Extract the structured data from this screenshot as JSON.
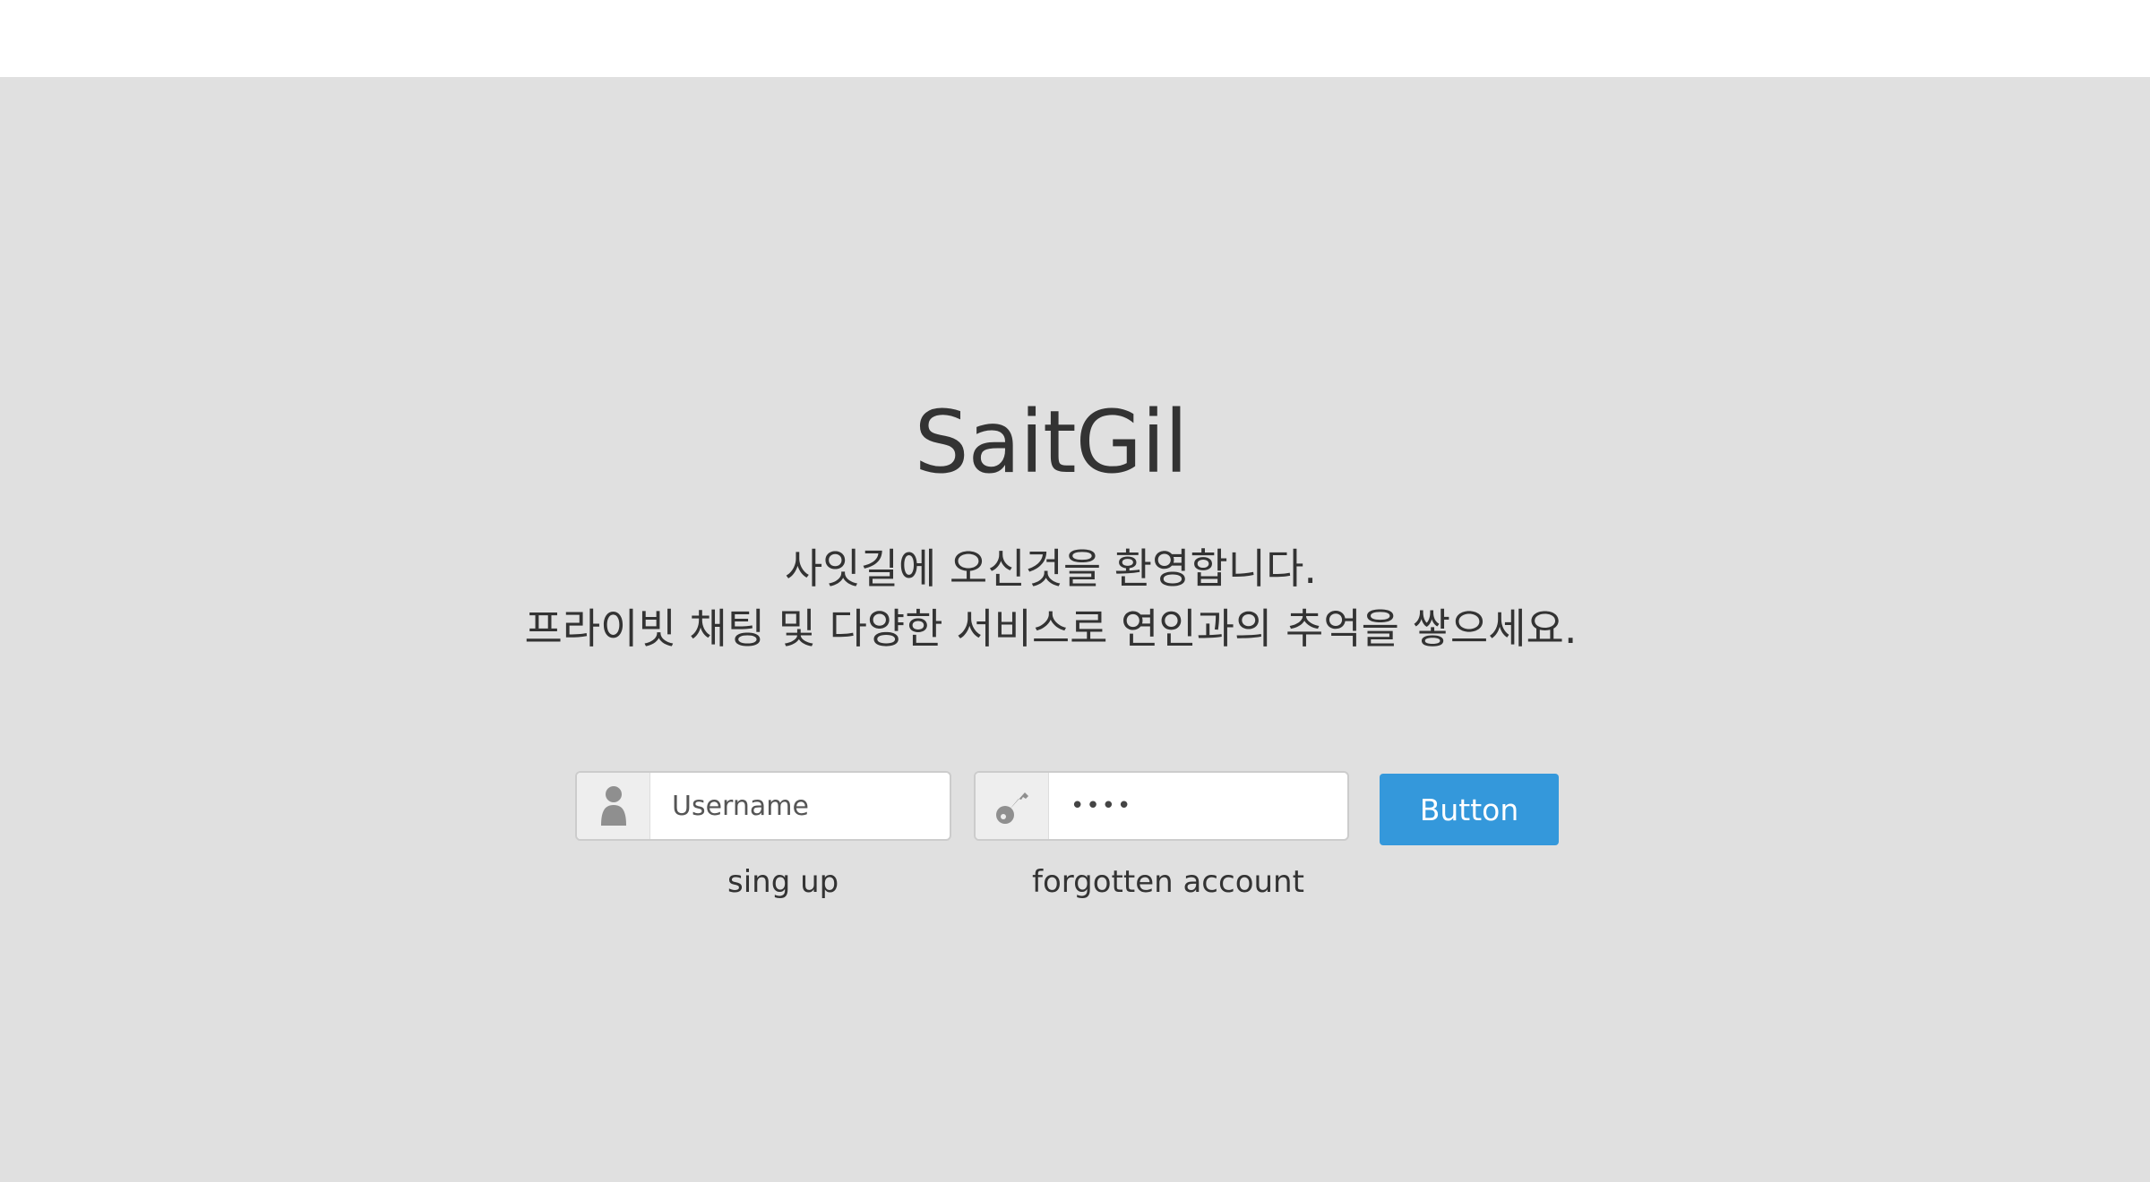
{
  "brand": {
    "title": "SaitGil"
  },
  "welcome": {
    "line1": "사잇길에 오신것을 환영합니다.",
    "line2": "프라이빗 채팅 및 다양한 서비스로 연인과의 추억을 쌓으세요."
  },
  "login": {
    "username": {
      "icon": "user-icon",
      "placeholder": "Username",
      "value": ""
    },
    "password": {
      "icon": "key-icon",
      "value": "••••"
    },
    "submit_label": "Button"
  },
  "links": {
    "signup": "sing up",
    "forgot": "forgotten account"
  },
  "colors": {
    "background": "#e0e0e0",
    "topbar": "#ffffff",
    "button": "#3498db",
    "text": "#333333"
  }
}
